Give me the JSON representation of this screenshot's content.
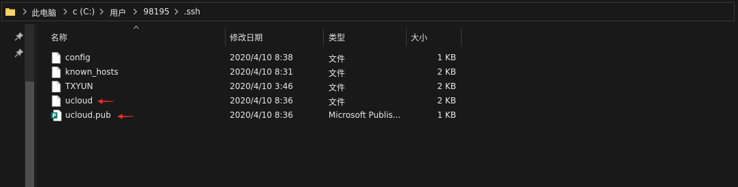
{
  "breadcrumb": {
    "items": [
      {
        "label": "此电脑"
      },
      {
        "label": "c (C:)"
      },
      {
        "label": "用户"
      },
      {
        "label": "98195"
      },
      {
        "label": ".ssh"
      }
    ]
  },
  "columns": {
    "name": "名称",
    "date": "修改日期",
    "type": "类型",
    "size": "大小"
  },
  "files": [
    {
      "name": "config",
      "date": "2020/4/10 8:38",
      "type": "文件",
      "size": "1 KB",
      "icon": "file-icon"
    },
    {
      "name": "known_hosts",
      "date": "2020/4/10 8:31",
      "type": "文件",
      "size": "2 KB",
      "icon": "file-icon"
    },
    {
      "name": "TXYUN",
      "date": "2020/4/10 3:46",
      "type": "文件",
      "size": "2 KB",
      "icon": "file-icon"
    },
    {
      "name": "ucloud",
      "date": "2020/4/10 8:36",
      "type": "文件",
      "size": "2 KB",
      "icon": "file-icon",
      "highlighted": true
    },
    {
      "name": "ucloud.pub",
      "date": "2020/4/10 8:36",
      "type": "Microsoft Publis...",
      "size": "1 KB",
      "icon": "publisher-file-icon",
      "highlighted": true
    }
  ],
  "colors": {
    "background": "#191919",
    "annotation_arrow": "#e8302a",
    "folder": "#f3c64a",
    "publisher": "#077568"
  }
}
